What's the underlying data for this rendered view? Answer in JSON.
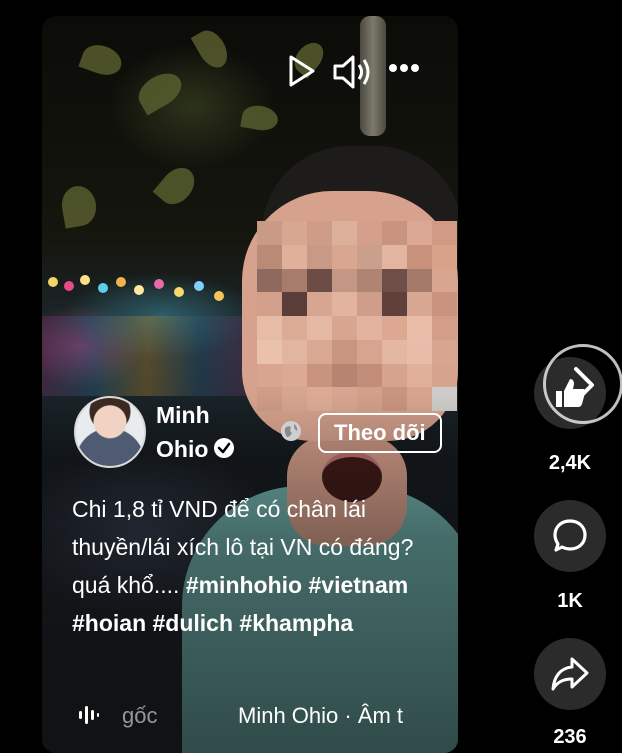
{
  "video": {
    "author_first": "Minh",
    "author_last": "Ohio",
    "follow_label": "Theo dõi",
    "caption_text": "Chi 1,8 tỉ VND để có chân lái thuyền/lái xích lô tại VN có đáng? quá khổ.... ",
    "hashtags": [
      "#minhohio",
      "#vietnam",
      "#hoian",
      "#dulich",
      "#khampha"
    ],
    "sound_original": "gốc",
    "sound_marquee": "Minh Ohio · Âm t"
  },
  "actions": {
    "likes": "2,4K",
    "comments": "1K",
    "shares": "236"
  },
  "icons": [
    "play-icon",
    "volume-icon",
    "more-icon",
    "verified-badge-icon",
    "globe-icon",
    "music-bars-icon",
    "like-icon",
    "comment-icon",
    "share-icon",
    "next-video-icon"
  ],
  "colors": {
    "background": "#000000",
    "action_button": "#2b2b2b",
    "text": "#ffffff"
  }
}
